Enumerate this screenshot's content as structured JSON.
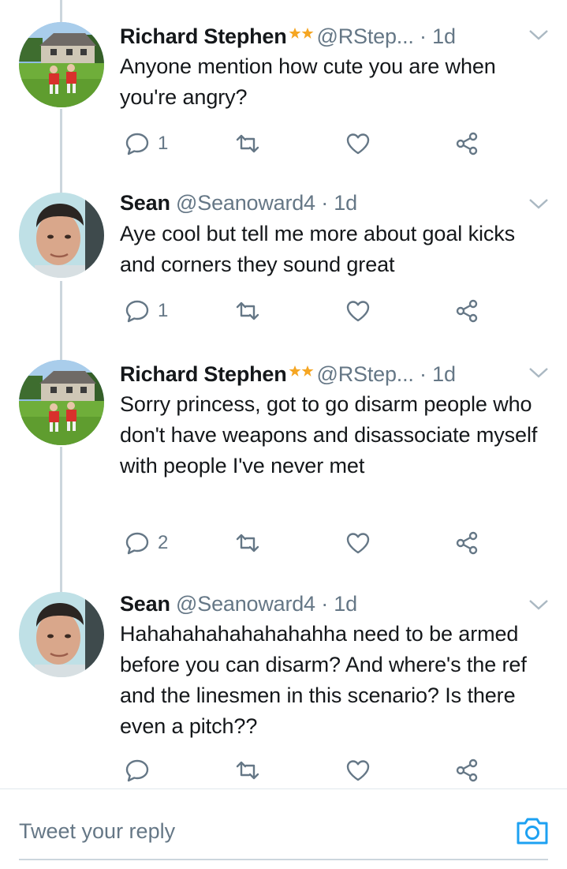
{
  "tweets": [
    {
      "name": "Richard Stephen",
      "handle": "@RStep...",
      "dot": "·",
      "time": "1d",
      "text": "Anyone mention how cute you are when you're angry?",
      "reply_count": "1",
      "has_stars": true,
      "avatar": "avatar-house-kids"
    },
    {
      "name": "Sean",
      "handle": "@Seanoward4",
      "dot": "·",
      "time": "1d",
      "text": "Aye cool but tell me more about goal kicks and corners they sound great",
      "reply_count": "1",
      "has_stars": false,
      "avatar": "avatar-man"
    },
    {
      "name": "Richard Stephen",
      "handle": "@RStep...",
      "dot": "·",
      "time": "1d",
      "text": "Sorry princess, got to go disarm people who don't have weapons and disassociate myself with people I've never met",
      "reply_count": "2",
      "has_stars": true,
      "avatar": "avatar-house-kids"
    },
    {
      "name": "Sean",
      "handle": "@Seanoward4",
      "dot": "·",
      "time": "1d",
      "text": "Hahahahahahahahahha need to be armed before you can disarm? And where's the ref and the linesmen in this scenario? Is there even a pitch??",
      "reply_count": "",
      "has_stars": false,
      "avatar": "avatar-man"
    }
  ],
  "reply_bar": {
    "placeholder": "Tweet your reply",
    "icon": "camera-icon"
  },
  "colors": {
    "icon_gray": "#657786",
    "thread_line": "#ccd6dd",
    "accent": "#1da1f2",
    "star": "#f5a623"
  }
}
